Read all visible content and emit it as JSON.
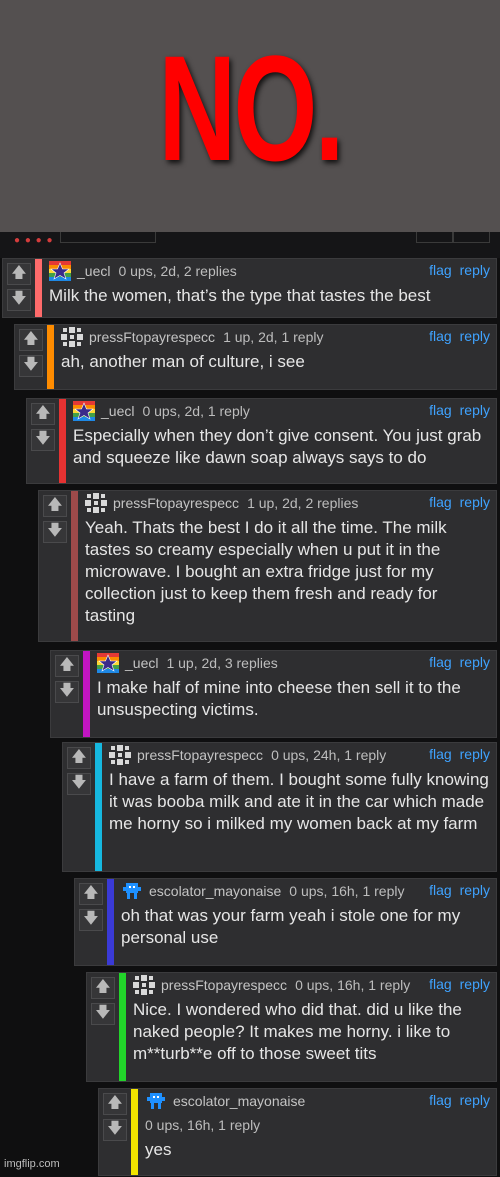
{
  "banner": {
    "title": "NO."
  },
  "comments": [
    {
      "user": "_uecl",
      "stats": "0 ups, 2d, 2 replies",
      "text": "Milk the women, that’s the type that tastes the best",
      "color": "#ff6b6b",
      "avatar": "rainbow-star-icon"
    },
    {
      "user": "pressFtopayrespecc",
      "stats": "1 up, 2d, 1 reply",
      "text": "ah, another man of culture, i see",
      "color": "#ff8c00",
      "avatar": "cross-pattern-icon"
    },
    {
      "user": "_uecl",
      "stats": "0 ups, 2d, 1 reply",
      "text": "Especially when they don’t give consent. You just grab and squeeze like dawn soap always says to do",
      "color": "#e63232",
      "avatar": "rainbow-star-icon"
    },
    {
      "user": "pressFtopayrespecc",
      "stats": "1 up, 2d, 2 replies",
      "text": "Yeah. Thats the best I do it all the time. The milk tastes so creamy especially when u put it in the microwave. I bought an extra fridge just for my collection just to keep them fresh and ready for tasting",
      "color": "#9e4a4a",
      "avatar": "cross-pattern-icon"
    },
    {
      "user": "_uecl",
      "stats": "1 up, 2d, 3 replies",
      "text": "I make half of mine into cheese then sell it to the unsuspecting victims.",
      "color": "#c215c2",
      "avatar": "rainbow-star-icon"
    },
    {
      "user": "pressFtopayrespecc",
      "stats": "0 ups, 24h, 1 reply",
      "text": "I have a farm of them. I bought some fully knowing it was booba milk and ate it in the car which made me horny so i milked my women back at my farm",
      "color": "#16b8e0",
      "avatar": "cross-pattern-icon"
    },
    {
      "user": "escolator_mayonaise",
      "stats": "0 ups, 16h, 1 reply",
      "text": "oh that was your farm yeah i stole one for my personal use",
      "color": "#3a3ad6",
      "avatar": "blue-creature-icon"
    },
    {
      "user": "pressFtopayrespecc",
      "stats": "0 ups, 16h, 1 reply",
      "text": "Nice. I wondered who did that. did u like the naked people? It makes me horny. i like to m**turb**e off to those sweet tits",
      "color": "#22d42a",
      "avatar": "cross-pattern-icon"
    },
    {
      "user": "escolator_mayonaise",
      "stats": "0 ups, 16h, 1 reply",
      "text": "yes",
      "color": "#f2e400",
      "avatar": "blue-creature-icon"
    }
  ],
  "labels": {
    "flag": "flag",
    "reply": "reply"
  },
  "watermark": "imgflip.com"
}
